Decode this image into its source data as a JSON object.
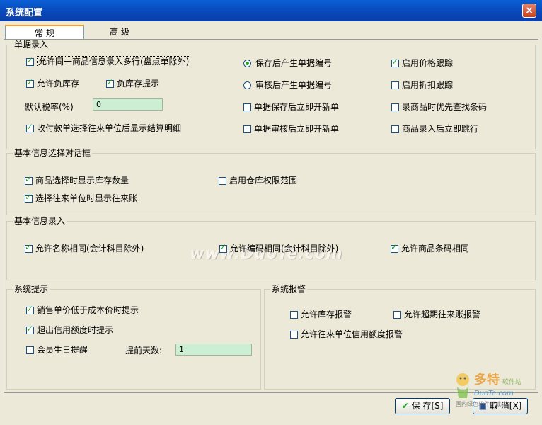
{
  "window": {
    "title": "系统配置",
    "close": "×"
  },
  "tabs": [
    {
      "label": "常 规"
    },
    {
      "label": "高 级"
    }
  ],
  "groups": {
    "document_entry": {
      "title": "单据录入",
      "allow_multi_line": "允许同一商品信息录入多行(盘点单除外)",
      "allow_negative_stock": "允许负库存",
      "negative_stock_hint": "负库存提示",
      "default_tax_label": "默认税率(%)",
      "default_tax_value": "0",
      "show_settlement_detail": "收付款单选择往来单位后显示结算明细",
      "radio_after_save": "保存后产生单据编号",
      "radio_after_audit": "审核后产生单据编号",
      "open_new_after_save": "单据保存后立即开新单",
      "open_new_after_audit": "单据审核后立即开新单",
      "price_tracking": "启用价格跟踪",
      "discount_tracking": "启用折扣跟踪",
      "barcode_first": "录商品时优先查找条码",
      "jump_line": "商品录入后立即跳行"
    },
    "basic_dialog": {
      "title": "基本信息选择对话框",
      "show_stock_qty": "商品选择时显示库存数量",
      "show_partner_account": "选择往来单位时显示往来账",
      "warehouse_permission": "启用仓库权限范围"
    },
    "basic_entry": {
      "title": "基本信息录入",
      "same_name": "允许名称相同(会计科目除外)",
      "same_code": "允许编码相同(会计科目除外)",
      "same_barcode": "允许商品条码相同"
    },
    "system_hints": {
      "title": "系统提示",
      "below_cost": "销售单价低于成本价时提示",
      "over_credit": "超出信用额度时提示",
      "birthday": "会员生日提醒",
      "days_label": "提前天数:",
      "days_value": "1"
    },
    "system_alarm": {
      "title": "系统报警",
      "stock_alarm": "允许库存报警",
      "overdue_alarm": "允许超期往来账报警",
      "credit_alarm": "允许往来单位信用额度报警"
    }
  },
  "buttons": {
    "save": "保 存[S]",
    "cancel": "取 消[X]"
  },
  "watermark": "www.DuoTe.com",
  "logo": {
    "brand": "多特",
    "sub": "软件站",
    "url": "DuoTe.com",
    "caption": "国内绿色软件下载站"
  },
  "colors": {
    "title_bar": "#0A47B8",
    "check": "#21A121",
    "input_bg": "#CCEFD3",
    "tab_accent": "#F9A02A"
  }
}
